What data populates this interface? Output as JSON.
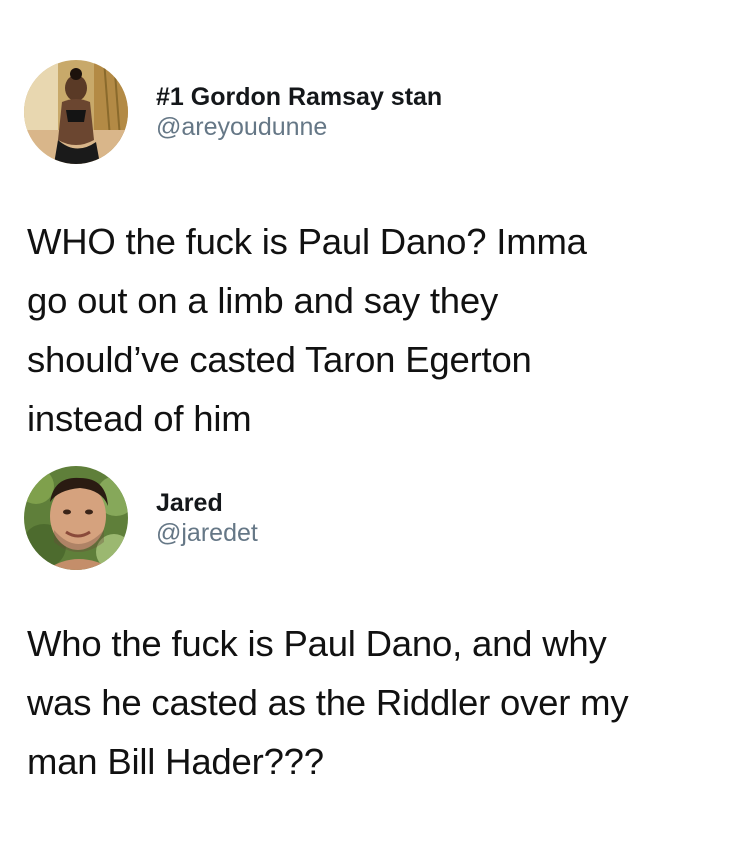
{
  "tweets": [
    {
      "display_name": "#1 Gordon Ramsay stan",
      "handle": "@areyoudunne",
      "text_lines": [
        "WHO the fuck is Paul Dano? Imma",
        "go out on a limb and say they",
        "should’ve casted Taron Egerton",
        "instead of him"
      ]
    },
    {
      "display_name": "Jared",
      "handle": "@jaredet",
      "text_lines": [
        "Who the fuck is Paul Dano, and why",
        "was he casted as the Riddler over my",
        "man Bill Hader???"
      ]
    }
  ],
  "colors": {
    "handle": "#657786",
    "name": "#14171a",
    "text": "#111111"
  }
}
